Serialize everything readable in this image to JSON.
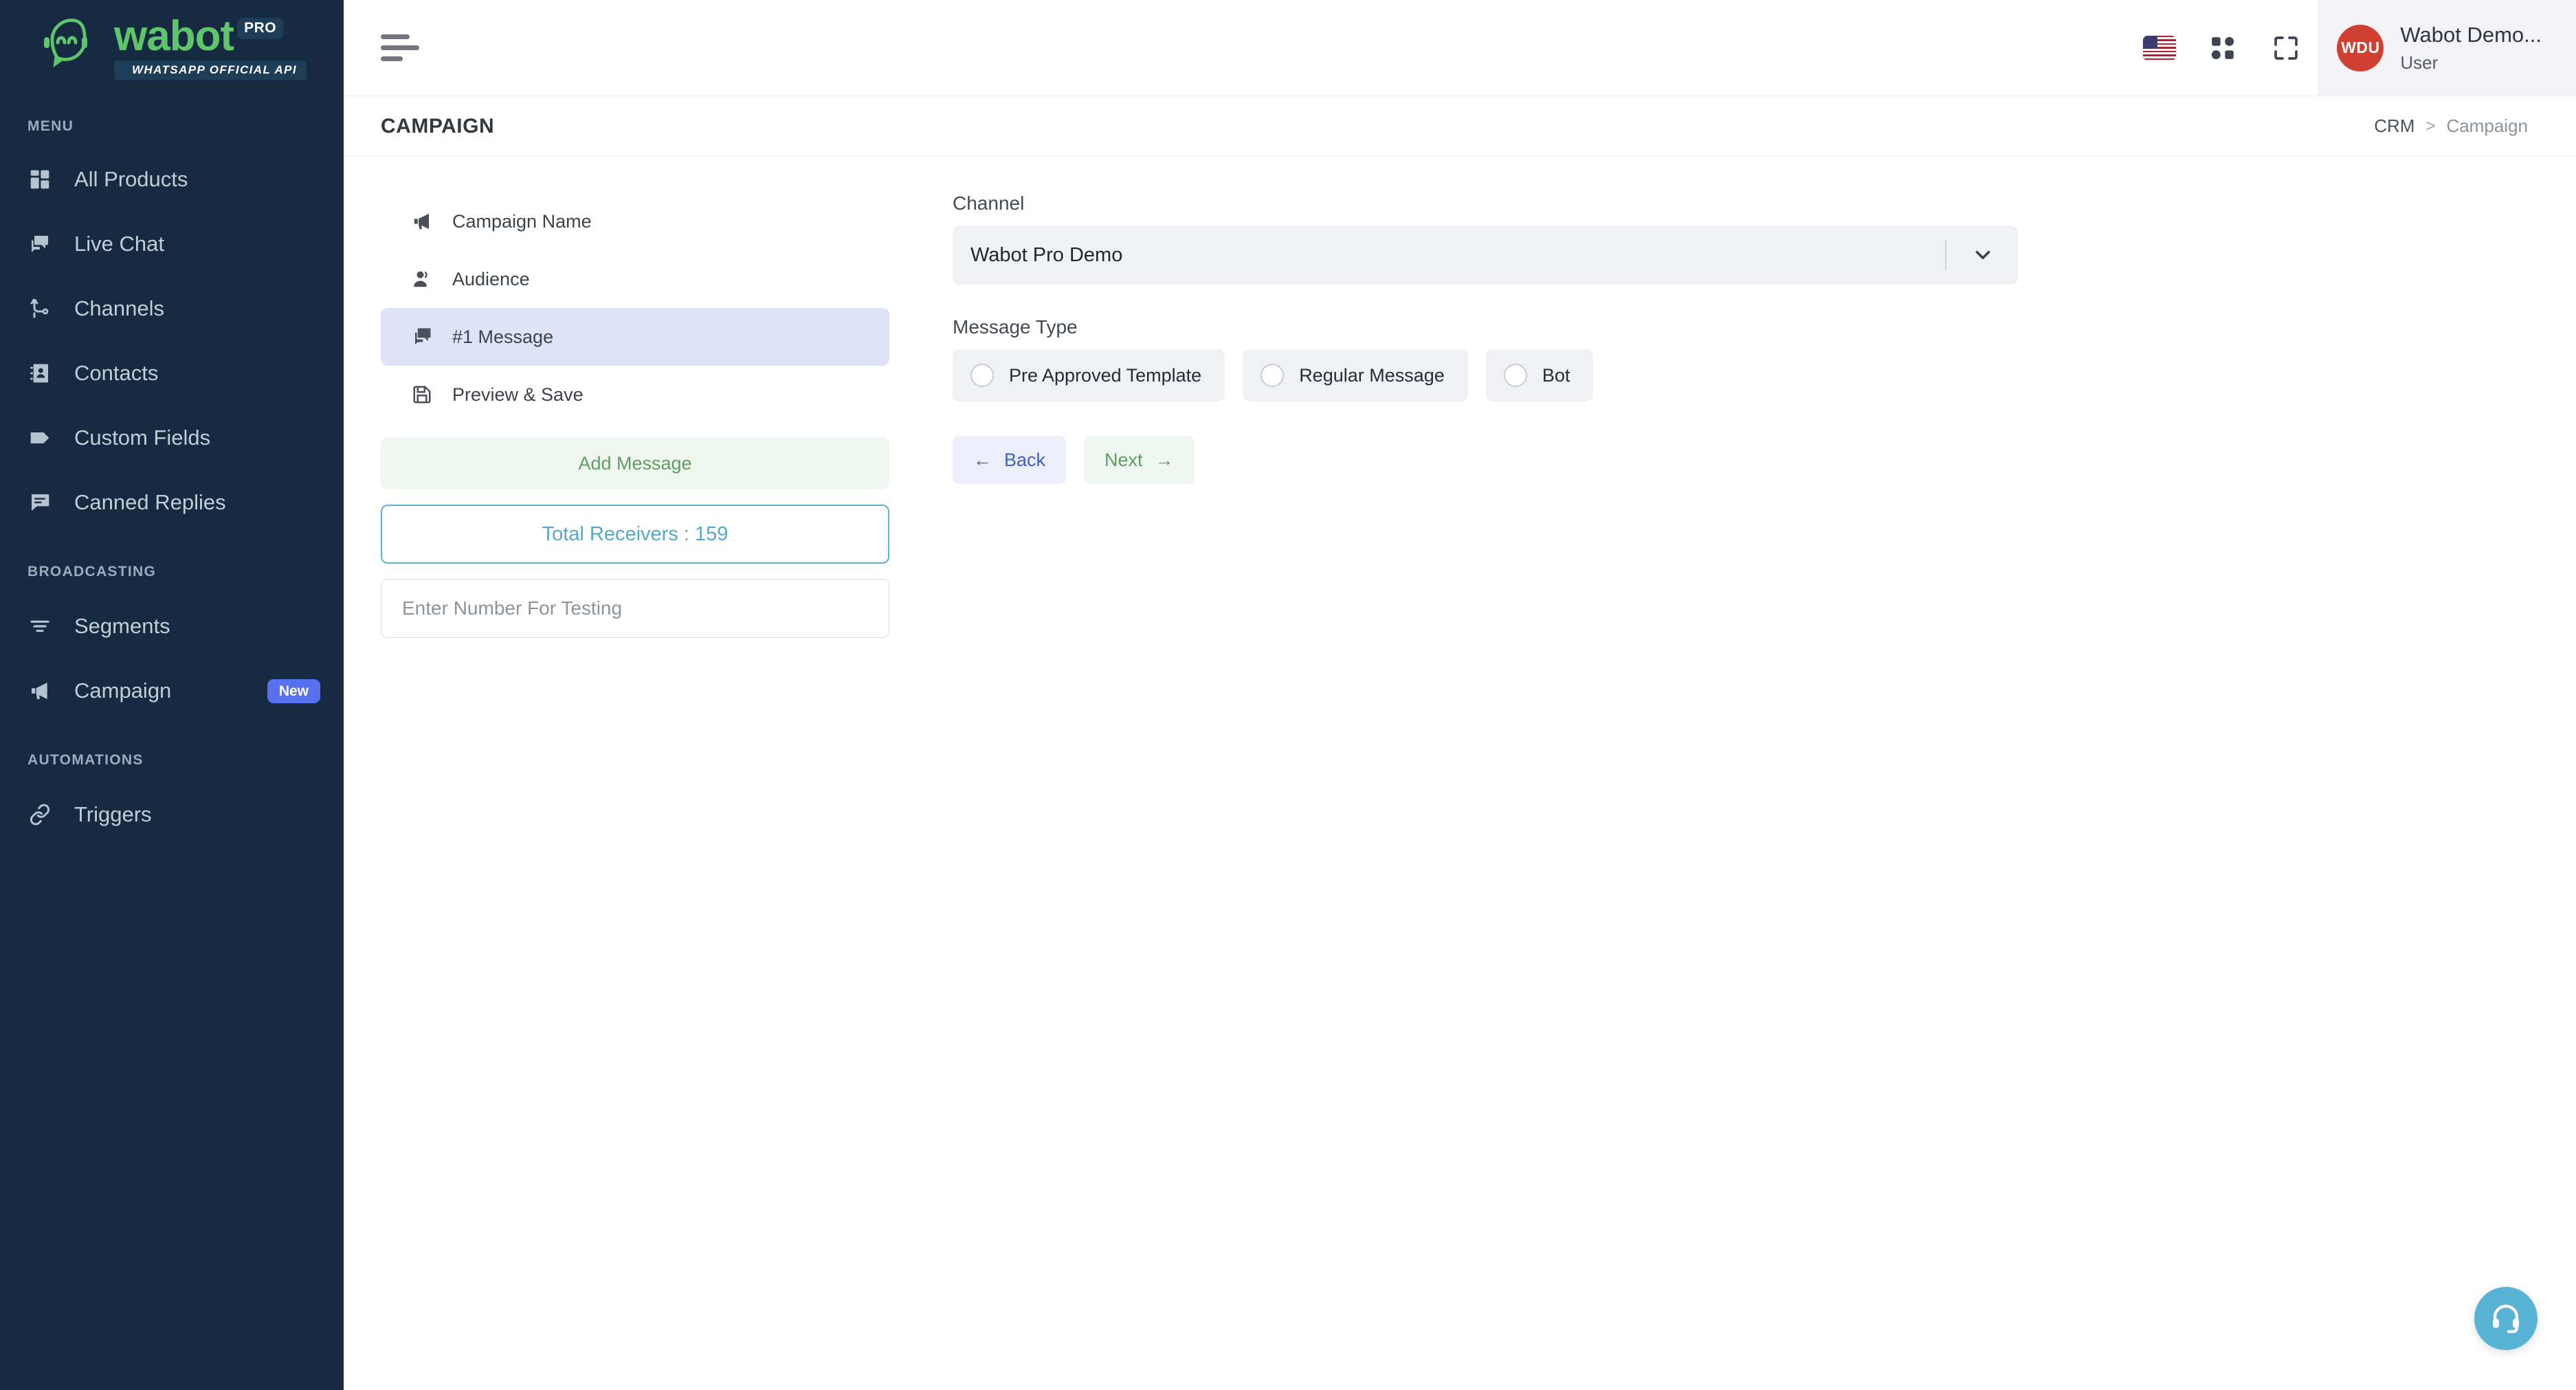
{
  "brand": {
    "name": "wabot",
    "pro_badge": "PRO",
    "tagline": "WHATSAPP OFFICIAL API",
    "accent_green": "#5ec56a",
    "sidebar_bg": "#162B41"
  },
  "sidebar": {
    "sections": [
      {
        "label": "MENU",
        "items": [
          {
            "label": "All Products",
            "icon": "grid-icon",
            "badge": ""
          },
          {
            "label": "Live Chat",
            "icon": "chat-bubbles-icon",
            "badge": ""
          },
          {
            "label": "Channels",
            "icon": "channels-icon",
            "badge": ""
          },
          {
            "label": "Contacts",
            "icon": "contacts-book-icon",
            "badge": ""
          },
          {
            "label": "Custom Fields",
            "icon": "tag-icon",
            "badge": ""
          },
          {
            "label": "Canned Replies",
            "icon": "canned-reply-icon",
            "badge": ""
          }
        ]
      },
      {
        "label": "BROADCASTING",
        "items": [
          {
            "label": "Segments",
            "icon": "filter-icon",
            "badge": ""
          },
          {
            "label": "Campaign",
            "icon": "megaphone-icon",
            "badge": "New"
          }
        ]
      },
      {
        "label": "AUTOMATIONS",
        "items": [
          {
            "label": "Triggers",
            "icon": "link-icon",
            "badge": ""
          }
        ]
      }
    ],
    "badge_color": "#5871ef"
  },
  "topbar": {
    "menu_toggle": "hamburger-icon",
    "language_flag": "us-flag-icon",
    "apps_icon": "apps-grid-icon",
    "fullscreen_icon": "fullscreen-icon",
    "user": {
      "initials": "WDU",
      "name": "Wabot Demo...",
      "role": "User",
      "avatar_color": "#cf4032"
    }
  },
  "pagehead": {
    "title": "CAMPAIGN",
    "breadcrumb": {
      "root": "CRM",
      "separator": ">",
      "current": "Campaign"
    }
  },
  "steps": [
    {
      "label": "Campaign Name",
      "icon": "megaphone-icon",
      "active": false
    },
    {
      "label": "Audience",
      "icon": "person-icon",
      "active": false
    },
    {
      "label": "#1 Message",
      "icon": "message-icon",
      "active": true
    },
    {
      "label": "Preview & Save",
      "icon": "save-disk-icon",
      "active": false
    }
  ],
  "left_panel": {
    "add_message_label": "Add Message",
    "total_receivers_label": "Total Receivers : 159",
    "total_receivers_count": 159,
    "test_number_placeholder": "Enter Number For Testing",
    "test_number_value": ""
  },
  "form": {
    "channel_label": "Channel",
    "channel_value": "Wabot Pro Demo",
    "channel_chevron": "chevron-down-icon",
    "message_type_label": "Message Type",
    "message_type_options": [
      {
        "label": "Pre Approved Template",
        "selected": false
      },
      {
        "label": "Regular Message",
        "selected": false
      },
      {
        "label": "Bot",
        "selected": false
      }
    ],
    "back_label": "Back",
    "back_arrow": "←",
    "next_label": "Next",
    "next_arrow": "→"
  },
  "support": {
    "icon": "headset-icon",
    "color": "#59b3d4"
  }
}
